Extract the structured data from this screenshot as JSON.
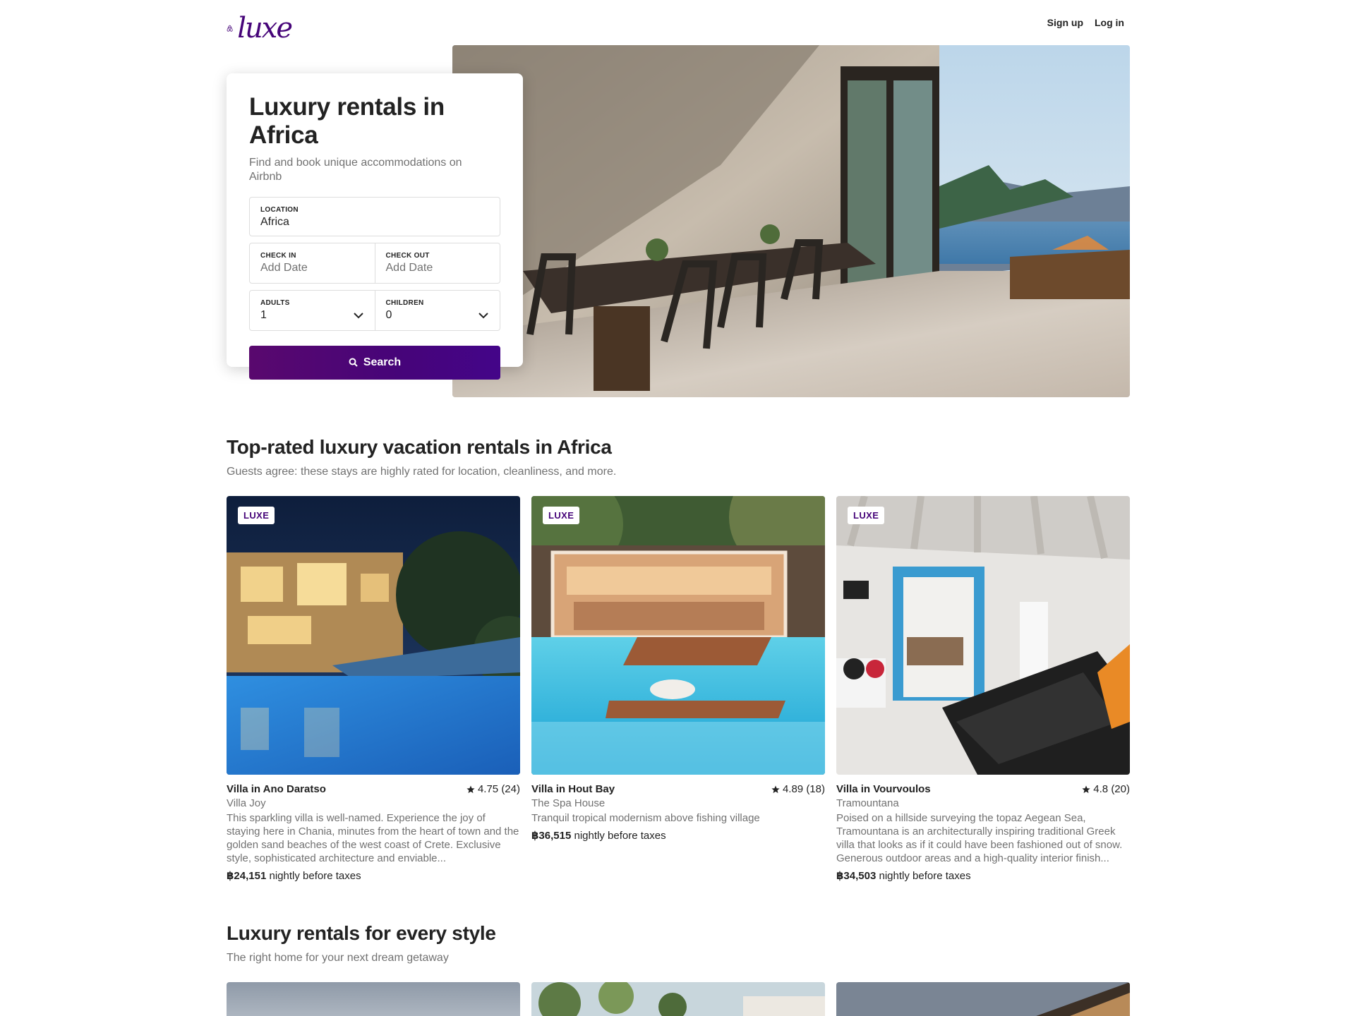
{
  "header": {
    "logo_text": "luxe",
    "signup_label": "Sign up",
    "login_label": "Log in"
  },
  "search": {
    "title": "Luxury rentals in Africa",
    "subtitle": "Find and book unique accommodations on Airbnb",
    "location_label": "LOCATION",
    "location_value": "Africa",
    "checkin_label": "CHECK IN",
    "checkin_placeholder": "Add Date",
    "checkout_label": "CHECK OUT",
    "checkout_placeholder": "Add Date",
    "adults_label": "ADULTS",
    "adults_value": "1",
    "children_label": "CHILDREN",
    "children_value": "0",
    "button_label": "Search"
  },
  "top_rated": {
    "title": "Top-rated luxury vacation rentals in Africa",
    "subtitle": "Guests agree: these stays are highly rated for location, cleanliness, and more.",
    "cards": [
      {
        "badge": "LUXE",
        "type": "Villa in Ano Daratso",
        "rating": "4.75 (24)",
        "name": "Villa Joy",
        "desc": "This sparkling villa is well-named. Experience the joy of staying here in Chania, minutes from the heart of town and the golden sand beaches of the west coast of Crete. Exclusive style, sophisticated architecture and enviable...",
        "price": "฿24,151",
        "price_suffix": " nightly before taxes"
      },
      {
        "badge": "LUXE",
        "type": "Villa in Hout Bay",
        "rating": "4.89 (18)",
        "name": "The Spa House",
        "desc": "Tranquil tropical modernism above fishing village",
        "price": "฿36,515",
        "price_suffix": " nightly before taxes"
      },
      {
        "badge": "LUXE",
        "type": "Villa in Vourvoulos",
        "rating": "4.8 (20)",
        "name": "Tramountana",
        "desc": "Poised on a hillside surveying the topaz Aegean Sea, Tramountana is an architecturally inspiring traditional Greek villa that looks as if it could have been fashioned out of snow. Generous outdoor areas and a high-quality interior finish...",
        "price": "฿34,503",
        "price_suffix": " nightly before taxes"
      }
    ]
  },
  "styles": {
    "title": "Luxury rentals for every style",
    "subtitle": "The right home for your next dream getaway"
  },
  "colors": {
    "brand": "#460479",
    "text": "#222222",
    "muted": "#717171"
  }
}
